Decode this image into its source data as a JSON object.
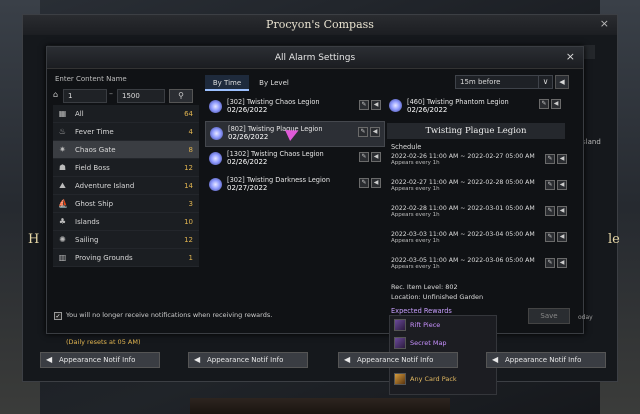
{
  "outer": {
    "title": "Procyon's Compass",
    "close": "×"
  },
  "modal": {
    "title": "All Alarm Settings",
    "close": "×"
  },
  "search": {
    "label": "Enter Content Name",
    "min": "1",
    "separator": "–",
    "max": "1500",
    "search_icon": "search-icon"
  },
  "categories": [
    {
      "label": "All",
      "count": "64",
      "icon": "grid-icon",
      "glyph": "▦"
    },
    {
      "label": "Fever Time",
      "count": "4",
      "icon": "flame-icon",
      "glyph": "♨"
    },
    {
      "label": "Chaos Gate",
      "count": "8",
      "icon": "gear-icon",
      "glyph": "✷",
      "selected": true
    },
    {
      "label": "Field Boss",
      "count": "12",
      "icon": "boss-icon",
      "glyph": "☗"
    },
    {
      "label": "Adventure Island",
      "count": "14",
      "icon": "island-icon",
      "glyph": "⛰"
    },
    {
      "label": "Ghost Ship",
      "count": "3",
      "icon": "ship-icon",
      "glyph": "⛵"
    },
    {
      "label": "Islands",
      "count": "10",
      "icon": "islands-icon",
      "glyph": "♣"
    },
    {
      "label": "Sailing",
      "count": "12",
      "icon": "sun-icon",
      "glyph": "✺"
    },
    {
      "label": "Proving Grounds",
      "count": "1",
      "icon": "pillar-icon",
      "glyph": "▥"
    }
  ],
  "tabs": {
    "by_time": "By Time",
    "by_level": "By Level"
  },
  "timing": {
    "selected": "15m before",
    "arrow": "∨"
  },
  "list": [
    {
      "name": "[302] Twisting Chaos Legion",
      "date": "02/26/2022"
    },
    {
      "name": "[802] Twisting Plague Legion",
      "date": "02/26/2022",
      "selected": true
    },
    {
      "name": "[1302] Twisting Chaos Legion",
      "date": "02/26/2022"
    },
    {
      "name": "[302] Twisting Darkness Legion",
      "date": "02/27/2022"
    }
  ],
  "right_top": {
    "name": "[460] Twisting Phantom Legion",
    "date": "02/26/2022"
  },
  "detail": {
    "title": "Twisting Plague Legion",
    "schedule_heading": "Schedule",
    "schedule": [
      {
        "range": "2022-02-26 11:00 AM ~ 2022-02-27 05:00 AM",
        "repeat": "Appears every 1h"
      },
      {
        "range": "2022-02-27 11:00 AM ~ 2022-02-28 05:00 AM",
        "repeat": "Appears every 1h"
      },
      {
        "range": "2022-02-28 11:00 AM ~ 2022-03-01 05:00 AM",
        "repeat": "Appears every 1h"
      },
      {
        "range": "2022-03-03 11:00 AM ~ 2022-03-04 05:00 AM",
        "repeat": "Appears every 1h"
      },
      {
        "range": "2022-03-05 11:00 AM ~ 2022-03-06 05:00 AM",
        "repeat": "Appears every 1h"
      }
    ],
    "rec_level": "Rec. Item Level: 802",
    "location": "Location: Unfinished Garden",
    "rewards_heading": "Expected Rewards",
    "rewards": [
      {
        "label": "Rift Piece",
        "tier": "purple"
      },
      {
        "label": "Secret Map",
        "tier": "purple"
      },
      {
        "label": "Rage",
        "tier": "purple"
      },
      {
        "label": "Any Card Pack",
        "tier": "gold"
      }
    ]
  },
  "footer": {
    "checkbox_label": "You will no longer receive notifications when receiving rewards.",
    "check": "✓",
    "save": "Save",
    "today": "oday",
    "daily": "(Daily resets at 05 AM)",
    "appearance": "Appearance Notif Info"
  },
  "bg_text": {
    "left": "H",
    "right": "le",
    "island": "sland"
  }
}
